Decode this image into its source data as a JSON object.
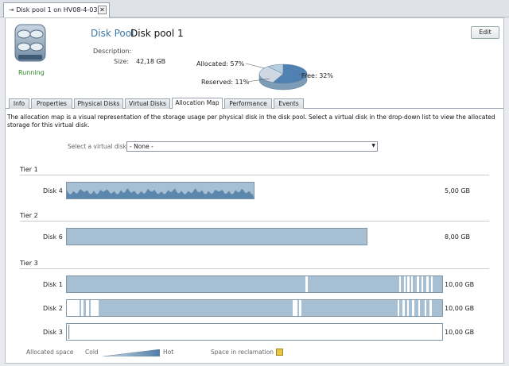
{
  "document_tab": {
    "title": "Disk pool 1 on HV08-4-03",
    "close_icon": "close-icon"
  },
  "header": {
    "icon": "disk-pool-icon",
    "status": "Running",
    "title_key": "Disk Pool",
    "title_value": "Disk pool 1",
    "edit_label": "Edit",
    "description_label": "Description:",
    "size_label": "Size:",
    "size_value": "42,18 GB"
  },
  "usage_pie": {
    "allocated_label": "Allocated: 57%",
    "reserved_label": "Reserved: 11%",
    "free_label": "Free: 32%",
    "allocated_pct": 57,
    "reserved_pct": 11,
    "free_pct": 32,
    "colors": {
      "allocated": "#4f82b3",
      "reserved": "#b7cde0",
      "free": "#cfd8e2"
    }
  },
  "tabs": [
    {
      "label": "Info"
    },
    {
      "label": "Properties"
    },
    {
      "label": "Physical Disks"
    },
    {
      "label": "Virtual Disks"
    },
    {
      "label": "Allocation Map",
      "active": true
    },
    {
      "label": "Performance"
    },
    {
      "label": "Events"
    }
  ],
  "allocation_map": {
    "intro": "The allocation map is a visual representation of the storage usage per physical disk in the disk pool. Select a virtual disk in the drop-down list to view the allocated storage for this virtual disk.",
    "select_label": "Select a virtual disk:",
    "select_value": "- None -",
    "tiers": [
      {
        "name": "Tier 1",
        "disks": [
          {
            "name": "Disk 4",
            "size": "5,00 GB",
            "fill": 0.5,
            "style": "hot"
          }
        ]
      },
      {
        "name": "Tier 2",
        "disks": [
          {
            "name": "Disk 6",
            "size": "8,00 GB",
            "fill": 0.8,
            "style": "cold"
          }
        ]
      },
      {
        "name": "Tier 3",
        "disks": [
          {
            "name": "Disk 1",
            "size": "10,00 GB",
            "fill": 1.0,
            "style": "cold"
          },
          {
            "name": "Disk 2",
            "size": "10,00 GB",
            "fill": 1.0,
            "style": "cold"
          },
          {
            "name": "Disk 3",
            "size": "10,00 GB",
            "fill": 0.0,
            "style": "empty"
          }
        ]
      }
    ],
    "colors": {
      "cold": "#a7bfd2",
      "hot": "#5b87ad",
      "reclamation": "#e8c842"
    }
  },
  "legend": {
    "allocated": "Allocated space",
    "cold": "Cold",
    "hot": "Hot",
    "reclamation": "Space in reclamation"
  }
}
